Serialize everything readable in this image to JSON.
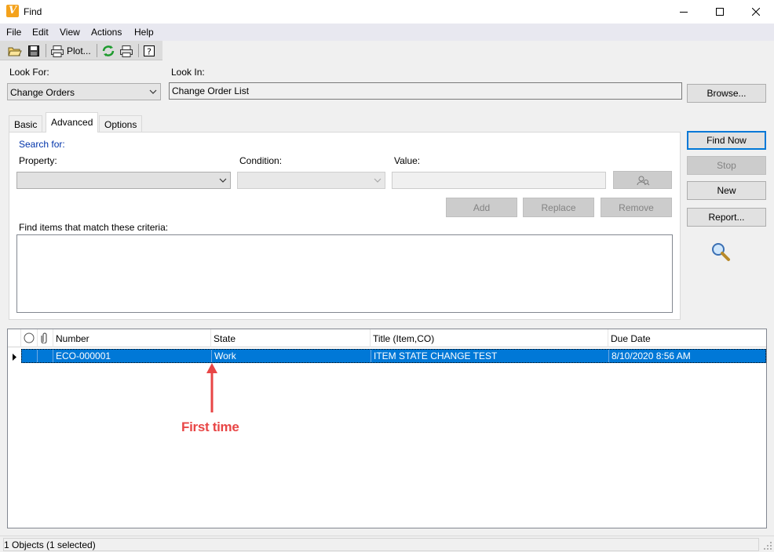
{
  "window": {
    "title": "Find",
    "app_logo_letter": "V"
  },
  "menu": [
    "File",
    "Edit",
    "View",
    "Actions",
    "Help"
  ],
  "toolbar": {
    "plot_label": "Plot..."
  },
  "look_for": {
    "label": "Look For:",
    "value": "Change Orders"
  },
  "look_in": {
    "label": "Look In:",
    "value": "Change Order List"
  },
  "buttons": {
    "browse": "Browse...",
    "find_now": "Find Now",
    "stop": "Stop",
    "new": "New",
    "report": "Report...",
    "add": "Add",
    "replace": "Replace",
    "remove": "Remove"
  },
  "tabs": [
    {
      "label": "Basic",
      "active": false
    },
    {
      "label": "Advanced",
      "active": true
    },
    {
      "label": "Options",
      "active": false
    }
  ],
  "advanced": {
    "search_for": "Search for:",
    "property_label": "Property:",
    "condition_label": "Condition:",
    "value_label": "Value:",
    "criteria_label": "Find items that match these criteria:"
  },
  "grid": {
    "columns": [
      "Number",
      "State",
      "Title (Item,CO)",
      "Due Date"
    ],
    "rows": [
      {
        "number": "ECO-000001",
        "state": "Work",
        "title": "ITEM STATE CHANGE TEST",
        "due_date": "8/10/2020 8:56 AM",
        "selected": true
      }
    ]
  },
  "annotation": {
    "text": "First time",
    "color": "#e84646"
  },
  "status": {
    "text": "1 Objects (1 selected)"
  },
  "colors": {
    "selection": "#0078d7",
    "accent_link": "#0033aa",
    "logo": "#f4a21c"
  }
}
